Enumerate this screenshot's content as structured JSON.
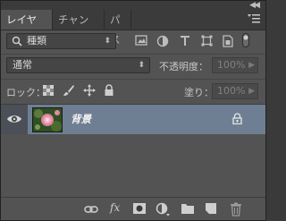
{
  "panel": {
    "tabs": [
      {
        "label": "レイヤー",
        "active": true
      },
      {
        "label": "チャンネル",
        "active": false
      },
      {
        "label": "パス",
        "active": false
      }
    ]
  },
  "filter": {
    "kind_label": "種類",
    "icons": [
      "image-filter-icon",
      "adjustment-filter-icon",
      "type-filter-icon",
      "shape-filter-icon",
      "smart-object-filter-icon",
      "filter-toggle-icon"
    ]
  },
  "blend": {
    "mode": "通常",
    "opacity_label": "不透明度：",
    "opacity_value": "100%"
  },
  "lock": {
    "label": "ロック：",
    "icons": [
      "lock-transparent-pixels-icon",
      "lock-image-pixels-icon",
      "lock-position-icon",
      "lock-all-icon"
    ],
    "fill_label": "塗り：",
    "fill_value": "100%"
  },
  "layers": [
    {
      "name": "背景",
      "visible": true,
      "locked": true,
      "selected": true
    }
  ],
  "bottom_icons": [
    "link-layers-icon",
    "fx-icon",
    "add-mask-icon",
    "adjustment-layer-icon",
    "new-group-icon",
    "new-layer-icon",
    "delete-layer-icon"
  ],
  "colors": {
    "panel_bg": "#535353",
    "selected_row": "#6f7f93",
    "text": "#d0d0d0"
  }
}
